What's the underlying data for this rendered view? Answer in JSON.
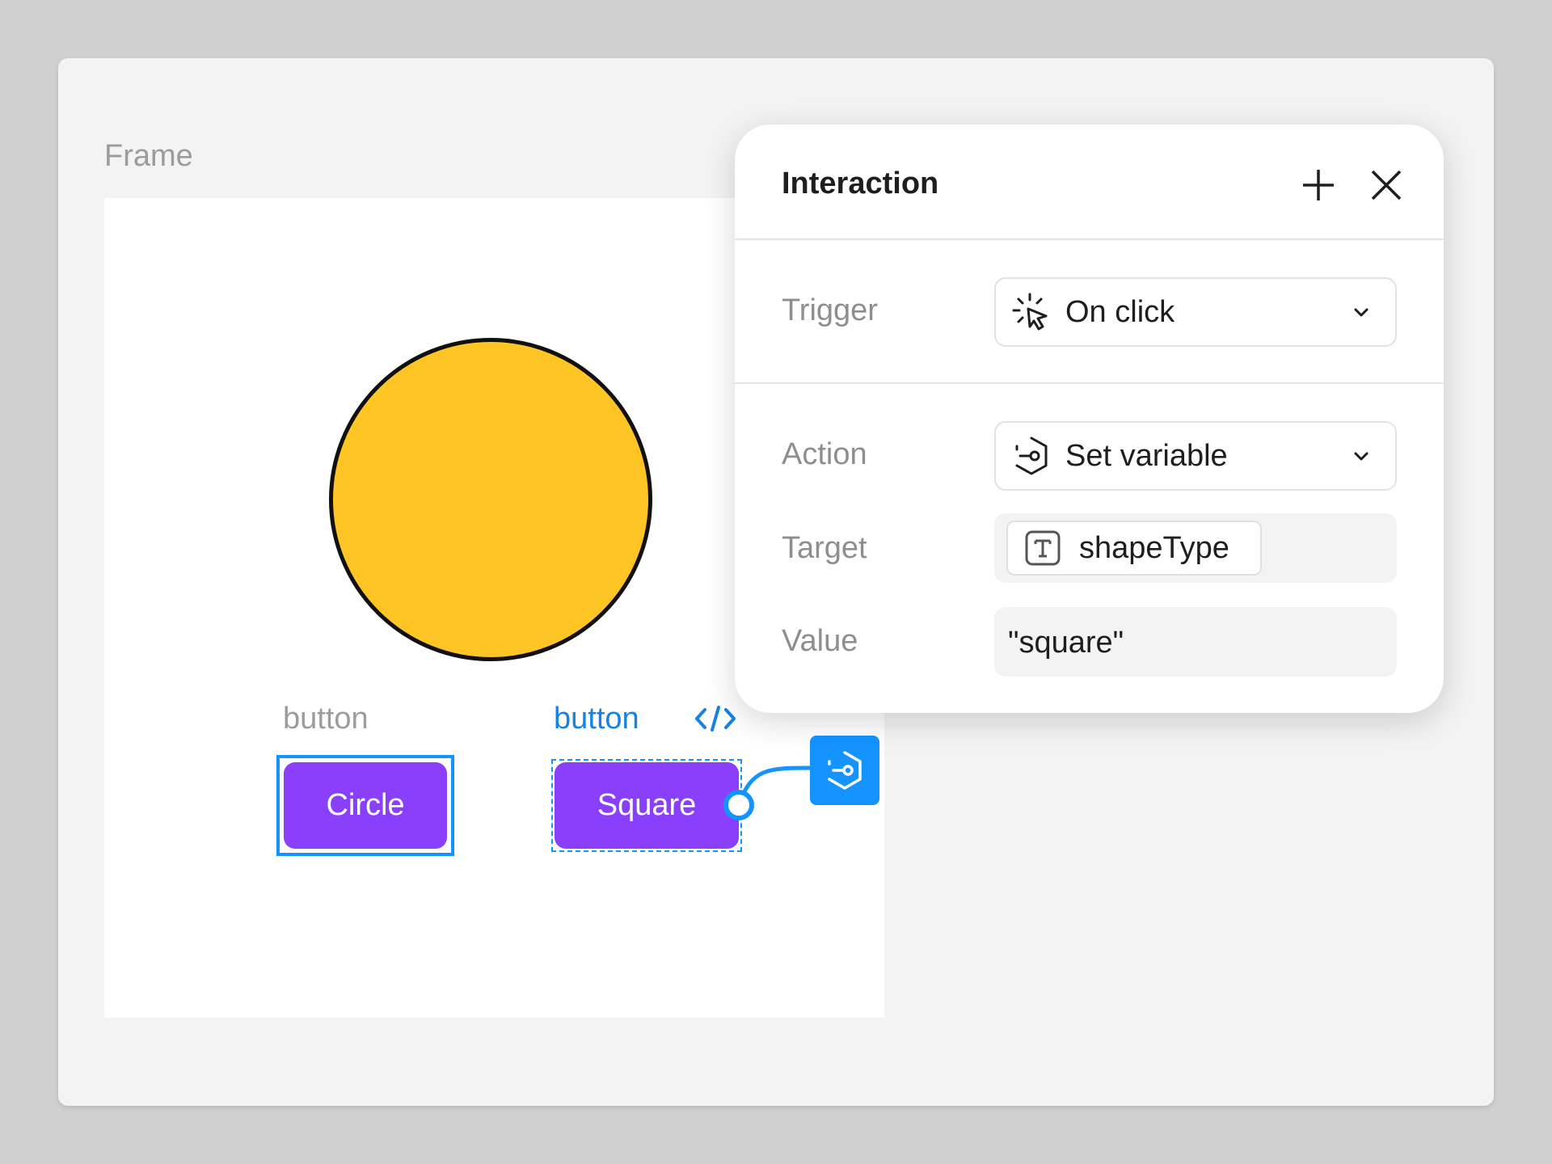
{
  "canvas": {
    "frame_label": "Frame",
    "circle_color": "#ffc524",
    "components": [
      {
        "label": "button",
        "button_text": "Circle",
        "state": "selected"
      },
      {
        "label": "button",
        "button_text": "Square",
        "state": "prototype-source"
      }
    ],
    "accent_color": "#1593ff",
    "button_color": "#8a3ffc",
    "code_icon": "code-icon",
    "action_node_icon": "set-variable-icon"
  },
  "panel": {
    "title": "Interaction",
    "add_icon": "plus-icon",
    "close_icon": "close-icon",
    "trigger": {
      "label": "Trigger",
      "value": "On click",
      "icon": "click-cursor-icon"
    },
    "action": {
      "label": "Action",
      "value": "Set variable",
      "icon": "set-variable-icon"
    },
    "target": {
      "label": "Target",
      "variable": "shapeType",
      "icon": "text-variable-icon"
    },
    "value": {
      "label": "Value",
      "text": "\"square\""
    }
  }
}
